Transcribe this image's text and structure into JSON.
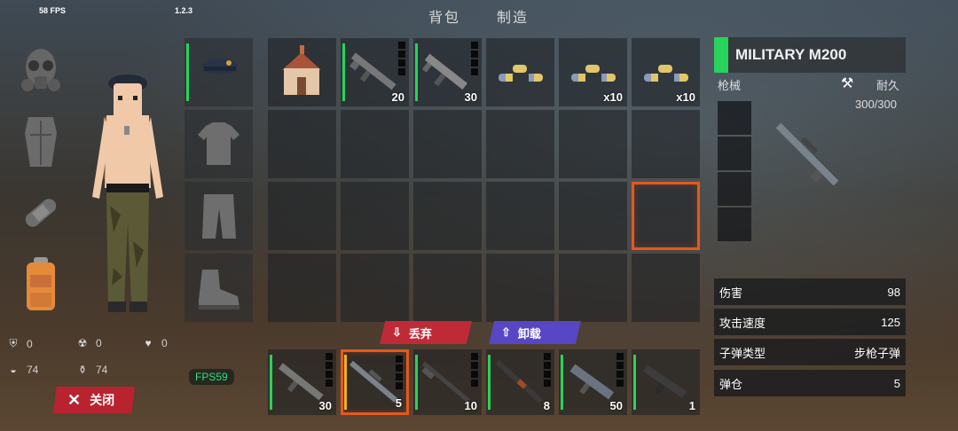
{
  "hud": {
    "fps_top": "58 FPS",
    "version": "1.2.3",
    "fps_badge": "FPS59"
  },
  "tabs": [
    {
      "label": "背包"
    },
    {
      "label": "制造"
    }
  ],
  "stats": [
    {
      "icon": "shield-icon",
      "value": "0"
    },
    {
      "icon": "radiation-icon",
      "value": "0"
    },
    {
      "icon": "heart-icon",
      "value": "0"
    },
    {
      "icon": "food-icon",
      "value": "74"
    },
    {
      "icon": "water-icon",
      "value": "74"
    }
  ],
  "equipment": [
    "helmet-slot",
    "chest-slot",
    "bandage-slot",
    "backpack-slot"
  ],
  "clothing": [
    "beret-icon",
    "tshirt-icon",
    "pants-icon",
    "boots-icon"
  ],
  "inventory": {
    "row0": [
      {
        "item": "house-icon",
        "count": ""
      },
      {
        "item": "assault-rifle-icon",
        "count": "20"
      },
      {
        "item": "smg-icon",
        "count": "30"
      },
      {
        "item": "ammo-icon",
        "count": ""
      },
      {
        "item": "ammo-icon",
        "count": "x10"
      },
      {
        "item": "ammo-icon",
        "count": "x10"
      }
    ]
  },
  "hotbar": [
    {
      "item": "assault-rifle-icon",
      "count": "30"
    },
    {
      "item": "sniper-rifle-icon",
      "count": "5"
    },
    {
      "item": "rifle-icon",
      "count": "10"
    },
    {
      "item": "shotgun-icon",
      "count": "8"
    },
    {
      "item": "smg-icon",
      "count": "50"
    },
    {
      "item": "pistol-rifle-icon",
      "count": "1"
    }
  ],
  "actions": {
    "drop_label": "丢弃",
    "unload_label": "卸载",
    "close_label": "关闭"
  },
  "item_info": {
    "name": "MILITARY M200",
    "category": "枪械",
    "durability_label": "耐久",
    "durability": "300/300",
    "stats": [
      {
        "label": "伤害",
        "value": "98"
      },
      {
        "label": "攻击速度",
        "value": "125"
      },
      {
        "label": "子弹类型",
        "value": "步枪子弹"
      },
      {
        "label": "弹仓",
        "value": "5"
      }
    ]
  },
  "colors": {
    "accent_green": "#27d35a",
    "select_orange": "#e5581e",
    "drop_red": "#c02a36",
    "unload_purple": "#5747c4"
  }
}
